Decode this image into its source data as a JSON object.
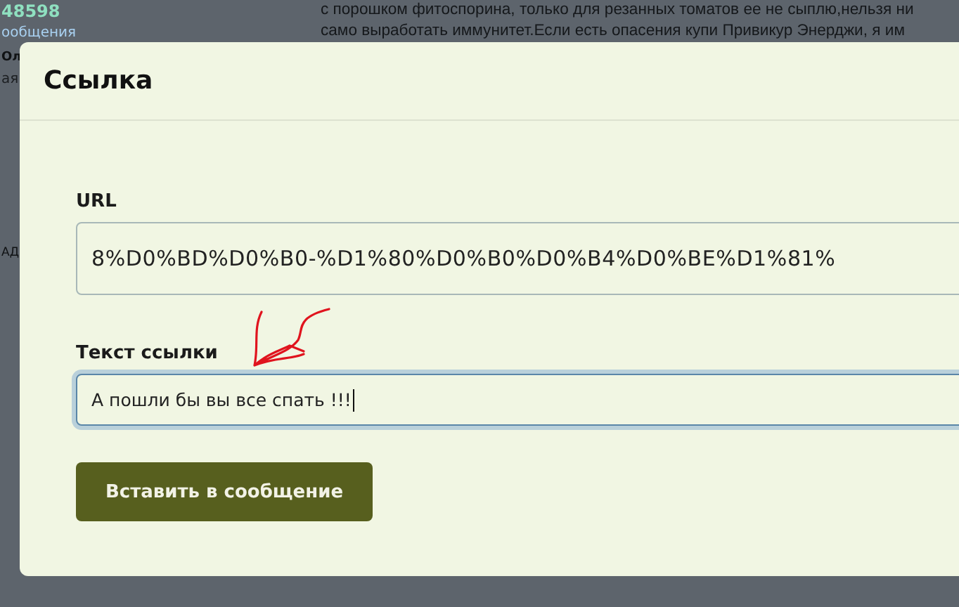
{
  "background_page": {
    "sidebar": {
      "count": "48598",
      "messages_label": "ообщения",
      "name_fragment": "Ол",
      "status_fragment": "ая",
      "side_fragment": "АД"
    },
    "post_lines": [
      "с порошком фитоспорина, только для резанных томатов ее не сыплю,нельзя ни",
      "само выработать иммунитет.Если есть опасения купи Привикур Энерджи, я им"
    ]
  },
  "dialog": {
    "title": "Ссылка",
    "fields": [
      {
        "label": "URL",
        "value": "8%D0%BD%D0%B0-%D1%80%D0%B0%D0%B4%D0%BE%D1%81%",
        "focused": false,
        "kind": "url"
      },
      {
        "label": "Текст ссылки",
        "value": "А пошли бы вы все спать !!!",
        "focused": true,
        "kind": "text"
      }
    ],
    "button": "Вставить в сообщение"
  }
}
